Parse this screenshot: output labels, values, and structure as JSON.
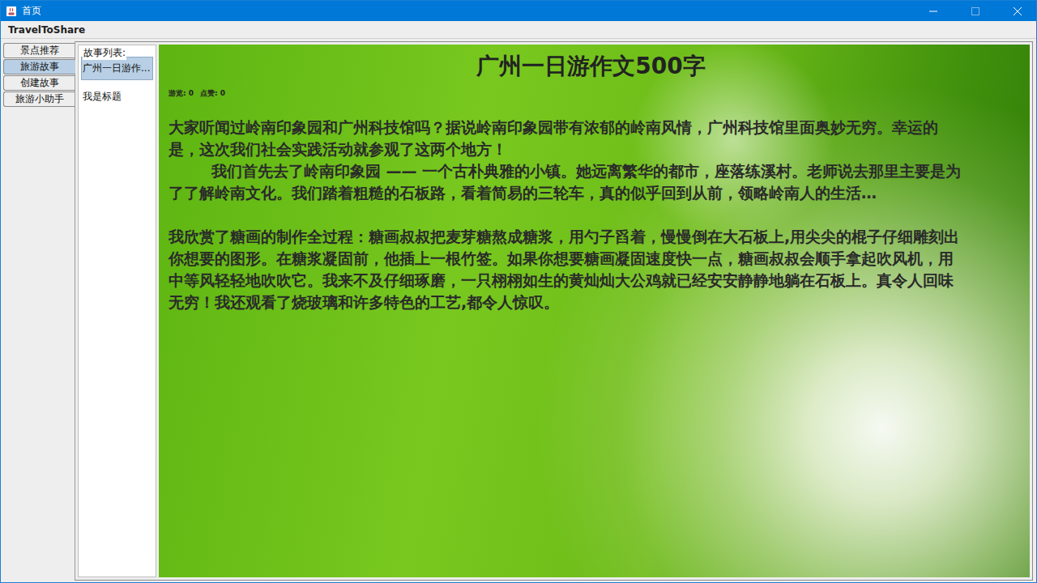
{
  "window": {
    "title": "首页"
  },
  "menu_bar": {
    "items": [
      "TravelToShare"
    ]
  },
  "tabs": [
    {
      "label": "景点推荐",
      "selected": false
    },
    {
      "label": "旅游故事",
      "selected": true
    },
    {
      "label": "创建故事",
      "selected": false
    },
    {
      "label": "旅游小助手",
      "selected": false
    }
  ],
  "story_list": {
    "title": "故事列表:",
    "items": [
      {
        "label": "广州一日游作...",
        "selected": true
      },
      {
        "label": "我是标题",
        "selected": false
      }
    ]
  },
  "story": {
    "title": "广州一日游作文500字",
    "stats": [
      "游览: 0",
      "点赞: 0"
    ],
    "paragraphs": [
      "大家听闻过岭南印象园和广州科技馆吗？据说岭南印象园带有浓郁的岭南风情，广州科技馆里面奥妙无穷。幸运的是，这次我们社会实践活动就参观了这两个地方！",
      "        我们首先去了岭南印象园 —— 一个古朴典雅的小镇。她远离繁华的都市，座落练溪村。老师说去那里主要是为了了解岭南文化。我们踏着粗糙的石板路，看着简易的三轮车，真的似乎回到从前，领略岭南人的生活…",
      "",
      "我欣赏了糖画的制作全过程：糖画叔叔把麦芽糖熬成糖浆，用勺子舀着，慢慢倒在大石板上,用尖尖的棍子仔细雕刻出你想要的图形。在糖浆凝固前，他插上一根竹签。如果你想要糖画凝固速度快一点，糖画叔叔会顺手拿起吹风机，用中等风轻轻地吹吹它。我来不及仔细琢磨，一只栩栩如生的黄灿灿大公鸡就已经安安静静地躺在石板上。真令人回味无穷！我还观看了烧玻璃和许多特色的工艺,都令人惊叹。"
    ]
  }
}
